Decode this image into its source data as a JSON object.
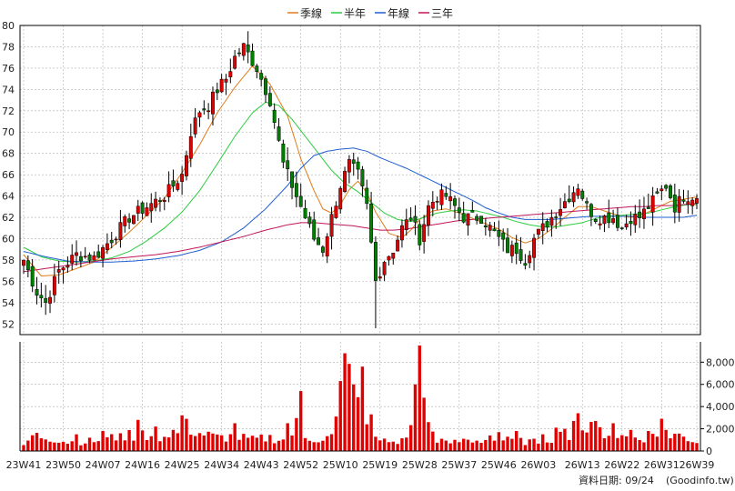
{
  "chart_data": {
    "type": "candlestick",
    "legend": [
      {
        "name": "季線",
        "color": "#e07b1a"
      },
      {
        "name": "半年",
        "color": "#2ecc40"
      },
      {
        "name": "年線",
        "color": "#1f5fd1"
      },
      {
        "name": "三年",
        "color": "#c0155a"
      }
    ],
    "colors": {
      "up": "#e00000",
      "down": "#008000",
      "volume": "#e00000",
      "wick": "#000000",
      "grid": "#b0b0b0",
      "axis": "#000000"
    },
    "price_axis": {
      "min": 51,
      "max": 80,
      "ticks": [
        52,
        54,
        56,
        58,
        60,
        62,
        64,
        66,
        68,
        70,
        72,
        74,
        76,
        78,
        80
      ]
    },
    "volume_axis": {
      "min": 0,
      "max": 9500,
      "ticks": [
        0,
        2000,
        4000,
        6000,
        8000
      ],
      "tick_labels": [
        "0",
        "2,000",
        "4,000",
        "6,000",
        "8,000"
      ]
    },
    "x_labels": [
      {
        "label": "23W41",
        "week": 0
      },
      {
        "label": "23W50",
        "week": 9
      },
      {
        "label": "24W07",
        "week": 18
      },
      {
        "label": "24W16",
        "week": 27
      },
      {
        "label": "24W25",
        "week": 36
      },
      {
        "label": "24W34",
        "week": 45
      },
      {
        "label": "24W43",
        "week": 54
      },
      {
        "label": "24W52",
        "week": 63
      },
      {
        "label": "25W10",
        "week": 72
      },
      {
        "label": "25W19",
        "week": 81
      },
      {
        "label": "25W28",
        "week": 90
      },
      {
        "label": "25W37",
        "week": 99
      },
      {
        "label": "25W46",
        "week": 108
      },
      {
        "label": "26W03",
        "week": 117
      },
      {
        "label": "26W13",
        "week": 127
      },
      {
        "label": "26W22",
        "week": 136
      },
      {
        "label": "26W31",
        "week": 145
      },
      {
        "label": "26W39",
        "week": 153
      }
    ],
    "weeks": 154,
    "close_anchors": [
      [
        0,
        58
      ],
      [
        3,
        55
      ],
      [
        5,
        54
      ],
      [
        8,
        57
      ],
      [
        12,
        58.5
      ],
      [
        16,
        58.2
      ],
      [
        20,
        60
      ],
      [
        24,
        62
      ],
      [
        28,
        63
      ],
      [
        32,
        64
      ],
      [
        36,
        66
      ],
      [
        38,
        70
      ],
      [
        40,
        72
      ],
      [
        42,
        72.5
      ],
      [
        44,
        74
      ],
      [
        46,
        75
      ],
      [
        48,
        77
      ],
      [
        50,
        78
      ],
      [
        53,
        76
      ],
      [
        56,
        73
      ],
      [
        59,
        67
      ],
      [
        62,
        64
      ],
      [
        64,
        62
      ],
      [
        66,
        60
      ],
      [
        68,
        59
      ],
      [
        70,
        62
      ],
      [
        72,
        65
      ],
      [
        74,
        67
      ],
      [
        76,
        66
      ],
      [
        78,
        63
      ],
      [
        80,
        56
      ],
      [
        82,
        58
      ],
      [
        84,
        59
      ],
      [
        86,
        61
      ],
      [
        88,
        62
      ],
      [
        90,
        60
      ],
      [
        92,
        63
      ],
      [
        94,
        64
      ],
      [
        96,
        64
      ],
      [
        98,
        63
      ],
      [
        100,
        62
      ],
      [
        102,
        62
      ],
      [
        104,
        62
      ],
      [
        106,
        61
      ],
      [
        108,
        60
      ],
      [
        110,
        59
      ],
      [
        112,
        59
      ],
      [
        114,
        58
      ],
      [
        116,
        60
      ],
      [
        118,
        61
      ],
      [
        120,
        62
      ],
      [
        122,
        63
      ],
      [
        124,
        64
      ],
      [
        126,
        65
      ],
      [
        128,
        63
      ],
      [
        130,
        62
      ],
      [
        132,
        62
      ],
      [
        134,
        62
      ],
      [
        136,
        61
      ],
      [
        138,
        62
      ],
      [
        140,
        62
      ],
      [
        142,
        63
      ],
      [
        144,
        64
      ],
      [
        146,
        65
      ],
      [
        148,
        63
      ],
      [
        150,
        64
      ],
      [
        153,
        64
      ]
    ],
    "volume_anchors": [
      [
        0,
        400
      ],
      [
        2,
        1400
      ],
      [
        6,
        1200
      ],
      [
        10,
        800
      ],
      [
        16,
        900
      ],
      [
        22,
        1300
      ],
      [
        28,
        1500
      ],
      [
        32,
        1200
      ],
      [
        34,
        1000
      ],
      [
        36,
        2400
      ],
      [
        40,
        1600
      ],
      [
        44,
        1200
      ],
      [
        48,
        1300
      ],
      [
        52,
        1000
      ],
      [
        56,
        1200
      ],
      [
        60,
        900
      ],
      [
        62,
        2300
      ],
      [
        64,
        1100
      ],
      [
        68,
        1100
      ],
      [
        70,
        1300
      ],
      [
        72,
        3800
      ],
      [
        74,
        6600
      ],
      [
        76,
        4200
      ],
      [
        78,
        3400
      ],
      [
        80,
        1000
      ],
      [
        84,
        800
      ],
      [
        86,
        900
      ],
      [
        88,
        2000
      ],
      [
        90,
        5200
      ],
      [
        92,
        2300
      ],
      [
        94,
        1100
      ],
      [
        96,
        700
      ],
      [
        100,
        900
      ],
      [
        104,
        1000
      ],
      [
        108,
        1000
      ],
      [
        112,
        900
      ],
      [
        116,
        800
      ],
      [
        120,
        1200
      ],
      [
        124,
        1600
      ],
      [
        128,
        2000
      ],
      [
        132,
        1700
      ],
      [
        136,
        1300
      ],
      [
        140,
        1200
      ],
      [
        144,
        1300
      ],
      [
        148,
        1500
      ],
      [
        152,
        1000
      ],
      [
        153,
        800
      ]
    ],
    "volume_spikes": [
      [
        12,
        1500
      ],
      [
        18,
        1800
      ],
      [
        22,
        1600
      ],
      [
        26,
        2800
      ],
      [
        30,
        2200
      ],
      [
        34,
        1900
      ],
      [
        37,
        2900
      ],
      [
        48,
        2500
      ],
      [
        60,
        2500
      ],
      [
        63,
        5400
      ],
      [
        72,
        6300
      ],
      [
        73,
        8800
      ],
      [
        75,
        6000
      ],
      [
        77,
        7600
      ],
      [
        79,
        3300
      ],
      [
        89,
        6000
      ],
      [
        90,
        9500
      ],
      [
        91,
        4800
      ],
      [
        92,
        2600
      ],
      [
        100,
        1100
      ],
      [
        106,
        1400
      ],
      [
        108,
        1700
      ],
      [
        112,
        1800
      ],
      [
        118,
        1500
      ],
      [
        121,
        2100
      ],
      [
        123,
        2000
      ],
      [
        125,
        2700
      ],
      [
        126,
        3400
      ],
      [
        130,
        2700
      ],
      [
        134,
        2500
      ],
      [
        138,
        1900
      ],
      [
        142,
        1800
      ],
      [
        145,
        2900
      ],
      [
        146,
        1900
      ]
    ],
    "ma_lines": {
      "季線": [
        [
          0,
          58.5
        ],
        [
          4,
          56.5
        ],
        [
          8,
          56.6
        ],
        [
          12,
          57.2
        ],
        [
          16,
          57.8
        ],
        [
          20,
          59.2
        ],
        [
          24,
          60.6
        ],
        [
          28,
          62.2
        ],
        [
          32,
          63.8
        ],
        [
          36,
          66.2
        ],
        [
          40,
          68.8
        ],
        [
          44,
          71.8
        ],
        [
          48,
          74.2
        ],
        [
          52,
          76.2
        ],
        [
          56,
          74.5
        ],
        [
          60,
          71.5
        ],
        [
          63,
          67.5
        ],
        [
          66,
          64.5
        ],
        [
          68,
          62.8
        ],
        [
          70,
          62.4
        ],
        [
          72,
          63.2
        ],
        [
          74,
          64.6
        ],
        [
          76,
          65.4
        ],
        [
          78,
          64.3
        ],
        [
          80,
          62.5
        ],
        [
          83,
          60.5
        ],
        [
          86,
          60.1
        ],
        [
          88,
          60.8
        ],
        [
          90,
          61.8
        ],
        [
          93,
          62.6
        ],
        [
          96,
          62.8
        ],
        [
          99,
          62.4
        ],
        [
          102,
          61.9
        ],
        [
          105,
          61.4
        ],
        [
          108,
          60.9
        ],
        [
          111,
          60.1
        ],
        [
          114,
          59.6
        ],
        [
          117,
          60.0
        ],
        [
          120,
          60.9
        ],
        [
          123,
          62.0
        ],
        [
          126,
          63.0
        ],
        [
          129,
          63.0
        ],
        [
          132,
          62.6
        ],
        [
          135,
          62.2
        ],
        [
          138,
          62.0
        ],
        [
          141,
          62.3
        ],
        [
          144,
          62.9
        ],
        [
          147,
          63.5
        ],
        [
          150,
          63.7
        ],
        [
          153,
          63.9
        ]
      ],
      "半年": [
        [
          0,
          59.2
        ],
        [
          4,
          58.3
        ],
        [
          8,
          57.9
        ],
        [
          12,
          57.8
        ],
        [
          16,
          57.9
        ],
        [
          20,
          58.2
        ],
        [
          24,
          58.8
        ],
        [
          28,
          59.8
        ],
        [
          32,
          61.0
        ],
        [
          36,
          62.5
        ],
        [
          40,
          64.5
        ],
        [
          44,
          67.0
        ],
        [
          48,
          69.6
        ],
        [
          52,
          71.8
        ],
        [
          55,
          72.8
        ],
        [
          58,
          72.5
        ],
        [
          61,
          71.2
        ],
        [
          64,
          69.6
        ],
        [
          67,
          68.0
        ],
        [
          70,
          66.4
        ],
        [
          73,
          65.2
        ],
        [
          76,
          64.4
        ],
        [
          79,
          63.4
        ],
        [
          82,
          62.4
        ],
        [
          85,
          61.8
        ],
        [
          88,
          61.6
        ],
        [
          91,
          62.0
        ],
        [
          94,
          62.4
        ],
        [
          97,
          62.6
        ],
        [
          100,
          62.7
        ],
        [
          103,
          62.6
        ],
        [
          106,
          62.3
        ],
        [
          109,
          62.0
        ],
        [
          112,
          61.6
        ],
        [
          115,
          61.3
        ],
        [
          118,
          61.1
        ],
        [
          121,
          61.1
        ],
        [
          124,
          61.3
        ],
        [
          127,
          61.5
        ],
        [
          130,
          61.9
        ],
        [
          133,
          62.1
        ],
        [
          136,
          62.2
        ],
        [
          139,
          62.3
        ],
        [
          142,
          62.4
        ],
        [
          145,
          62.7
        ],
        [
          148,
          63.0
        ],
        [
          151,
          63.2
        ],
        [
          153,
          63.2
        ]
      ],
      "年線": [
        [
          0,
          58.8
        ],
        [
          5,
          58.3
        ],
        [
          10,
          57.9
        ],
        [
          15,
          57.8
        ],
        [
          20,
          57.8
        ],
        [
          25,
          57.9
        ],
        [
          30,
          58.1
        ],
        [
          35,
          58.4
        ],
        [
          40,
          58.9
        ],
        [
          45,
          59.7
        ],
        [
          50,
          61.0
        ],
        [
          55,
          62.8
        ],
        [
          60,
          65.0
        ],
        [
          63,
          66.6
        ],
        [
          66,
          67.8
        ],
        [
          69,
          68.2
        ],
        [
          72,
          68.4
        ],
        [
          75,
          68.5
        ],
        [
          78,
          68.2
        ],
        [
          81,
          67.6
        ],
        [
          84,
          67.1
        ],
        [
          87,
          66.6
        ],
        [
          90,
          66.0
        ],
        [
          93,
          65.4
        ],
        [
          96,
          64.8
        ],
        [
          99,
          64.2
        ],
        [
          102,
          63.6
        ],
        [
          105,
          62.9
        ],
        [
          108,
          62.4
        ],
        [
          111,
          62.0
        ],
        [
          114,
          61.8
        ],
        [
          117,
          61.8
        ],
        [
          120,
          61.8
        ],
        [
          123,
          61.9
        ],
        [
          126,
          62.0
        ],
        [
          129,
          62.1
        ],
        [
          132,
          62.1
        ],
        [
          135,
          62.1
        ],
        [
          138,
          62.1
        ],
        [
          141,
          62.0
        ],
        [
          144,
          62.0
        ],
        [
          147,
          62.0
        ],
        [
          150,
          62.0
        ],
        [
          153,
          62.2
        ]
      ],
      "三年": [
        [
          0,
          56.9
        ],
        [
          5,
          57.2
        ],
        [
          10,
          57.5
        ],
        [
          15,
          57.8
        ],
        [
          20,
          58.1
        ],
        [
          25,
          58.3
        ],
        [
          30,
          58.5
        ],
        [
          35,
          58.8
        ],
        [
          40,
          59.2
        ],
        [
          45,
          59.7
        ],
        [
          50,
          60.2
        ],
        [
          55,
          60.8
        ],
        [
          60,
          61.3
        ],
        [
          63,
          61.5
        ],
        [
          66,
          61.5
        ],
        [
          69,
          61.4
        ],
        [
          72,
          61.3
        ],
        [
          75,
          61.2
        ],
        [
          78,
          61.0
        ],
        [
          81,
          60.8
        ],
        [
          84,
          60.8
        ],
        [
          87,
          60.9
        ],
        [
          90,
          61.1
        ],
        [
          93,
          61.3
        ],
        [
          96,
          61.5
        ],
        [
          99,
          61.7
        ],
        [
          102,
          61.8
        ],
        [
          105,
          61.9
        ],
        [
          108,
          62.0
        ],
        [
          111,
          62.1
        ],
        [
          114,
          62.2
        ],
        [
          117,
          62.3
        ],
        [
          120,
          62.4
        ],
        [
          123,
          62.5
        ],
        [
          126,
          62.6
        ],
        [
          129,
          62.7
        ],
        [
          132,
          62.8
        ],
        [
          135,
          62.9
        ],
        [
          138,
          63.0
        ],
        [
          141,
          63.0
        ],
        [
          144,
          63.1
        ],
        [
          147,
          63.1
        ],
        [
          150,
          63.2
        ],
        [
          153,
          63.3
        ]
      ]
    }
  },
  "footer": {
    "date_label": "資料日期: 09/24",
    "source": "(Goodinfo.tw)"
  }
}
